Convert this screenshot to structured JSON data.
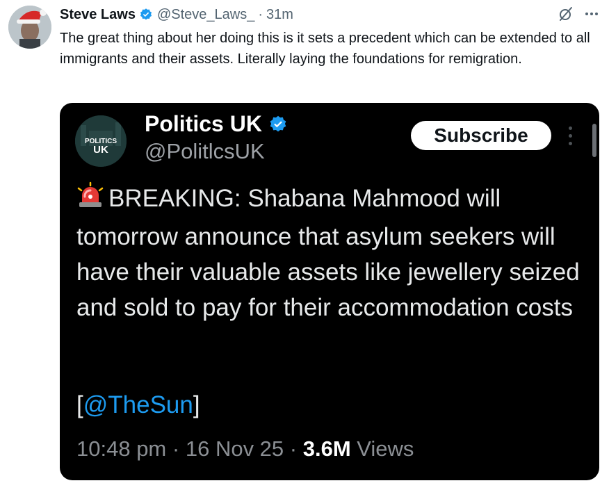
{
  "tweet": {
    "author_name": "Steve Laws",
    "handle": "@Steve_Laws_",
    "separator": "·",
    "time": "31m",
    "text": "The great thing about her doing this is it sets a precedent which can be extended to all immigrants and their assets. Literally laying the foundations for remigration.",
    "icons": {
      "avatar": "avatar-santa-hat",
      "verified": "verified-badge-icon",
      "grok": "grok-icon",
      "more": "more-horizontal-icon"
    }
  },
  "embedded": {
    "name": "Politics UK",
    "handle": "@PolitlcsUK",
    "avatar_text_top": "POLITICS",
    "avatar_text_bottom": "UK",
    "subscribe_label": "Subscribe",
    "body": "BREAKING: Shabana Mahmood will tomorrow announce that asylum seekers will have their valuable assets like jewellery seized and sold to pay for their accommodation costs",
    "source_open": "[",
    "source_mention": "@TheSun",
    "source_close": "]",
    "time": "10:48 pm",
    "date": "16 Nov 25",
    "sep": "·",
    "views_count": "3.6M",
    "views_label": "Views",
    "icons": {
      "siren": "siren-emoji-icon",
      "verified": "verified-badge-icon",
      "more": "more-vertical-icon"
    }
  },
  "colors": {
    "verified": "#1d9bf0",
    "mention": "#1d9bf0",
    "embed_bg": "#000000",
    "secondary_text": "#536471"
  }
}
